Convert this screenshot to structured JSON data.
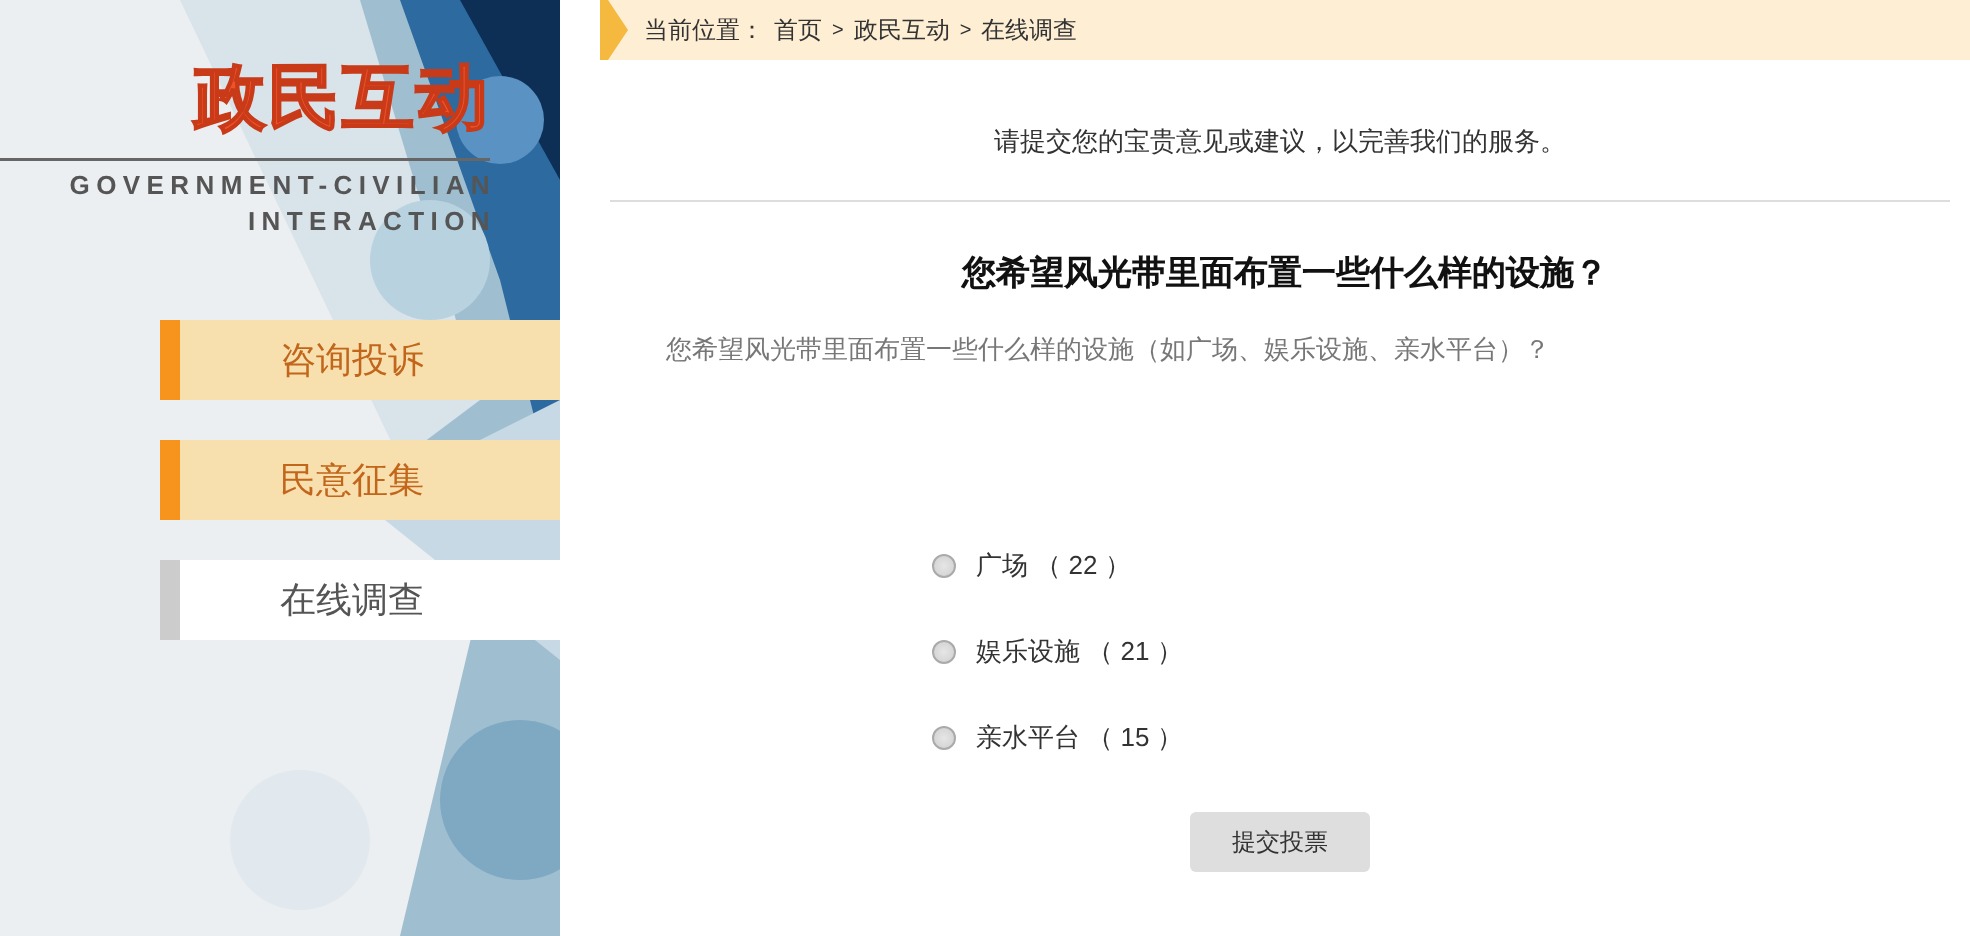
{
  "logo": {
    "title": "政民互动",
    "subtitle_lines": [
      "GOVERNMENT-CIVILIAN",
      "INTERACTION"
    ]
  },
  "sidebar": {
    "items": [
      {
        "label": "咨询投诉",
        "selected": false
      },
      {
        "label": "民意征集",
        "selected": false
      },
      {
        "label": "在线调查",
        "selected": true
      }
    ]
  },
  "breadcrumb": {
    "label": "当前位置：",
    "items": [
      {
        "kind": "link",
        "text": "首页"
      },
      {
        "kind": "separator",
        "text": ">"
      },
      {
        "kind": "link",
        "text": "政民互动"
      },
      {
        "kind": "separator",
        "text": ">"
      },
      {
        "kind": "link",
        "text": "在线调查"
      }
    ]
  },
  "intro": "请提交您的宝贵意见或建议，以完善我们的服务。",
  "survey": {
    "title": "您希望风光带里面布置一些什么样的设施？",
    "question": "您希望风光带里面布置一些什么样的设施（如广场、娱乐设施、亲水平台）？",
    "options": [
      {
        "label": "广场 （ 22 ）",
        "selected": false
      },
      {
        "label": "娱乐设施 （ 21 ）",
        "selected": false
      },
      {
        "label": "亲水平台 （ 15 ）",
        "selected": false
      }
    ],
    "submit": "提交投票"
  }
}
